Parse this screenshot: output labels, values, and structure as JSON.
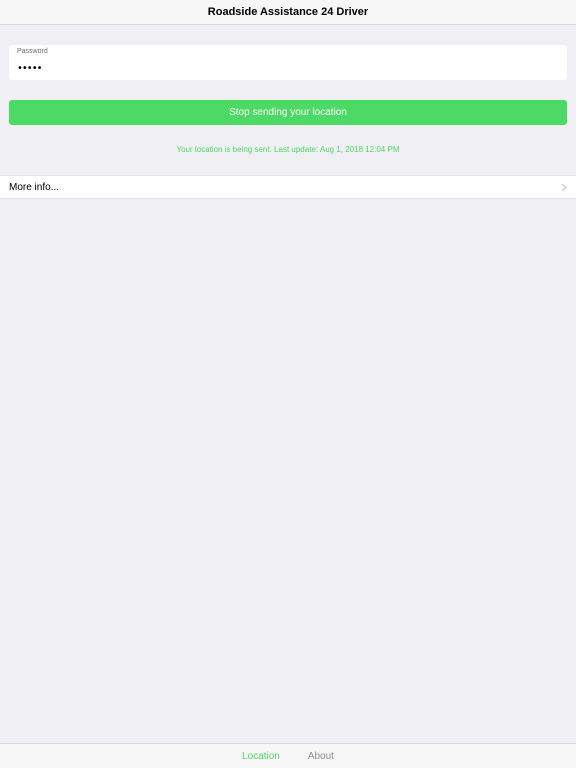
{
  "nav": {
    "title": "Roadside Assistance 24 Driver"
  },
  "password": {
    "label": "Password",
    "value": "•••••"
  },
  "stop_button": {
    "label": "Stop sending your location"
  },
  "status": {
    "text": "Your location is being sent. Last update: Aug 1, 2018 12:04 PM"
  },
  "more_info": {
    "label": "More info...",
    "icon": "chevron-right-icon"
  },
  "tabs": [
    {
      "label": "Location",
      "active": true
    },
    {
      "label": "About",
      "active": false
    }
  ],
  "colors": {
    "accent": "#4cd964",
    "background": "#efeff4",
    "inactive": "#8e8e93"
  }
}
